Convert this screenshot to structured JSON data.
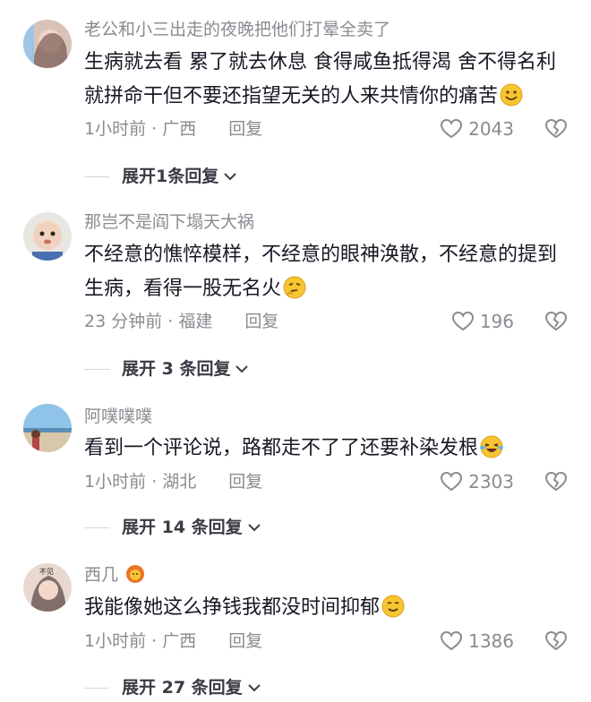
{
  "comments": [
    {
      "username": "老公和小三出走的夜晚把他们打晕全卖了",
      "text": "生病就去看  累了就去休息  食得咸鱼抵得渴  舍不得名利就拼命干但不要还指望无关的人来共情你的痛苦",
      "emoji": "smiling-face-emoji",
      "time": "1小时前 · 广西",
      "reply": "回复",
      "likes": "2043",
      "expand": "展开1条回复"
    },
    {
      "username": "那岂不是阎下塌天大祸",
      "text": "不经意的憔悴模样，不经意的眼神涣散，不经意的提到生病，看得一股无名火",
      "emoji": "thinking-face-emoji",
      "time": "23 分钟前 · 福建",
      "reply": "回复",
      "likes": "196",
      "expand": "展开 3 条回复"
    },
    {
      "username": "阿噗噗噗",
      "text": "看到一个评论说，路都走不了了还要补染发根",
      "emoji": "laughing-tears-emoji",
      "time": "1小时前 · 湖北",
      "reply": "回复",
      "likes": "2303",
      "expand": "展开 14 条回复"
    },
    {
      "username": "西几",
      "text": "我能像她这么挣钱我都没时间抑郁",
      "emoji": "smiling-face-emoji",
      "time": "1小时前 · 广西",
      "reply": "回复",
      "likes": "1386",
      "expand": "展开 27 条回复",
      "avatar_text": "不见"
    }
  ]
}
